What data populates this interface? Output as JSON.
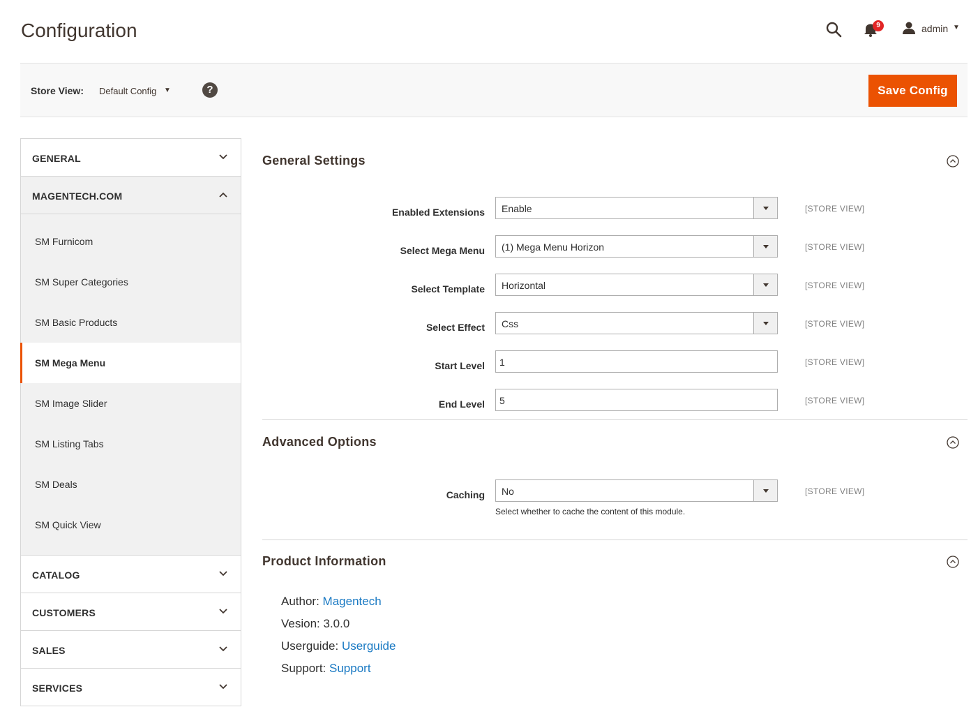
{
  "header": {
    "title": "Configuration",
    "notifications_count": "9",
    "user_name": "admin"
  },
  "store_bar": {
    "label": "Store View:",
    "value": "Default Config",
    "help": "?",
    "save_label": "Save Config"
  },
  "sidebar": {
    "groups_top": [
      {
        "label": "GENERAL"
      },
      {
        "label": "MAGENTECH.COM"
      }
    ],
    "magentech_items": [
      {
        "label": "SM Furnicom"
      },
      {
        "label": "SM Super Categories"
      },
      {
        "label": "SM Basic Products"
      },
      {
        "label": "SM Mega Menu",
        "active": true
      },
      {
        "label": "SM Image Slider"
      },
      {
        "label": "SM Listing Tabs"
      },
      {
        "label": "SM Deals"
      },
      {
        "label": "SM Quick View"
      }
    ],
    "groups_bottom": [
      {
        "label": "CATALOG"
      },
      {
        "label": "CUSTOMERS"
      },
      {
        "label": "SALES"
      },
      {
        "label": "SERVICES"
      }
    ]
  },
  "general_settings": {
    "title": "General Settings",
    "fields": [
      {
        "label": "Enabled Extensions",
        "value": "Enable",
        "type": "select",
        "scope": "[STORE VIEW]"
      },
      {
        "label": "Select Mega Menu",
        "value": "(1) Mega Menu Horizon",
        "type": "select",
        "scope": "[STORE VIEW]"
      },
      {
        "label": "Select Template",
        "value": "Horizontal",
        "type": "select",
        "scope": "[STORE VIEW]"
      },
      {
        "label": "Select Effect",
        "value": "Css",
        "type": "select",
        "scope": "[STORE VIEW]"
      },
      {
        "label": "Start Level",
        "value": "1",
        "type": "input",
        "scope": "[STORE VIEW]"
      },
      {
        "label": "End Level",
        "value": "5",
        "type": "input",
        "scope": "[STORE VIEW]"
      }
    ]
  },
  "advanced_options": {
    "title": "Advanced Options",
    "caching": {
      "label": "Caching",
      "value": "No",
      "scope": "[STORE VIEW]",
      "note": "Select whether to cache the content of this module."
    }
  },
  "product_information": {
    "title": "Product Information",
    "author_label": "Author:",
    "author_value": "Magentech",
    "version_label": "Vesion:",
    "version_value": "3.0.0",
    "userguide_label": "Userguide:",
    "userguide_value": "Userguide",
    "support_label": "Support:",
    "support_value": "Support"
  }
}
